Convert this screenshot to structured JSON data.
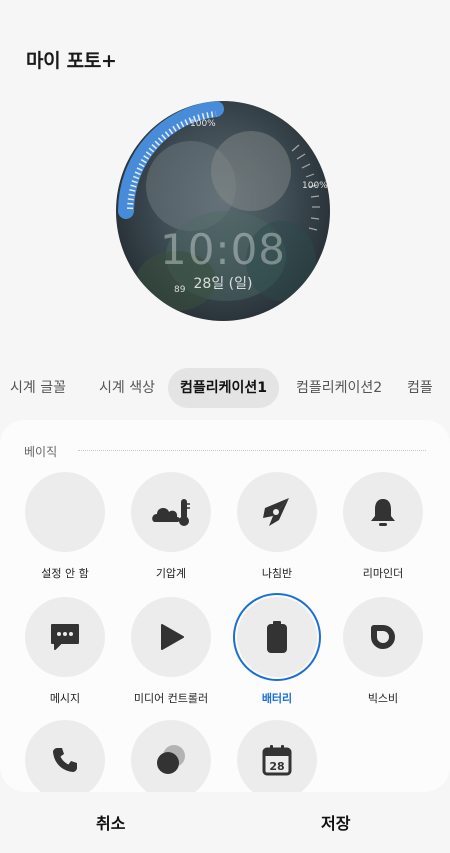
{
  "header": {
    "title": "마이 포토+"
  },
  "watch": {
    "time": "10:08",
    "date": "28일 (일)",
    "battery_percent_top": "100%",
    "battery_percent_right": "100%",
    "complication_small": "89"
  },
  "tabs": [
    {
      "label": "시계 글꼴",
      "active": false
    },
    {
      "label": "시계 색상",
      "active": false
    },
    {
      "label": "컴플리케이션1",
      "active": true
    },
    {
      "label": "컴플리케이션2",
      "active": false
    },
    {
      "label": "컴플",
      "active": false
    }
  ],
  "panel": {
    "section_title": "베이직",
    "items": [
      {
        "label": "설정 안 함",
        "icon": "none"
      },
      {
        "label": "기압계",
        "icon": "barometer-icon"
      },
      {
        "label": "나침반",
        "icon": "compass-icon"
      },
      {
        "label": "리마인더",
        "icon": "bell-icon"
      },
      {
        "label": "메시지",
        "icon": "message-icon"
      },
      {
        "label": "미디어 컨트롤러",
        "icon": "play-icon"
      },
      {
        "label": "배터리",
        "icon": "battery-icon",
        "selected": true
      },
      {
        "label": "빅스비",
        "icon": "bixby-icon"
      },
      {
        "label": "",
        "icon": "phone-icon"
      },
      {
        "label": "",
        "icon": "moon-icon"
      },
      {
        "label": "",
        "icon": "calendar-icon",
        "badge": "28"
      }
    ]
  },
  "footer": {
    "cancel_label": "취소",
    "save_label": "저장"
  },
  "colors": {
    "accent": "#1a6fd6",
    "icon": "#333333",
    "circle_bg": "#ececec"
  }
}
